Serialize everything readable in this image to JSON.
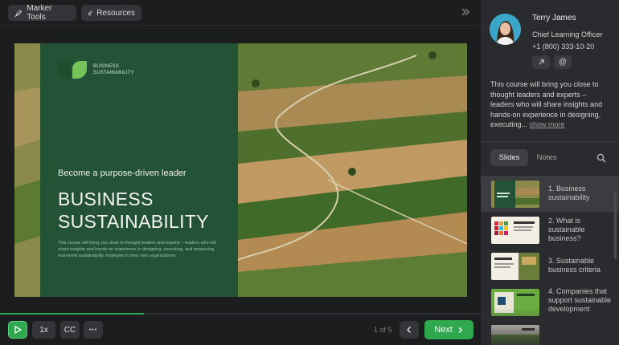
{
  "toolbar": {
    "marker_tools_label": "Marker Tools",
    "resources_label": "Resources",
    "collapse_icon": "double-chevron-right-icon"
  },
  "slide": {
    "logo_text_line1": "BUSINESS",
    "logo_text_line2": "SUSTAINABILITY",
    "kicker": "Become a purpose-driven leader",
    "title_line1": "BUSINESS",
    "title_line2": "SUSTAINABILITY",
    "description": "This course will bring you close to thought leaders and experts – leaders who will share insights and hands-on experience in designing, executing, and measuring real-world sustainability strategies in their own organizations."
  },
  "progress": {
    "fraction": 0.3,
    "color": "#2fa84f"
  },
  "controls": {
    "speed_label": "1x",
    "cc_label": "CC",
    "more_label": "•••",
    "pager": "1 of 5",
    "next_label": "Next"
  },
  "presenter": {
    "name": "Terry James",
    "role": "Chief Learning Officer",
    "phone": "+1 (800) 333-10-20"
  },
  "about": {
    "text": "This course will bring you close to thought leaders and experts – leaders who will share insights and hands-on experience in designing, executing... ",
    "more_label": "show more"
  },
  "tabs": {
    "slides": "Slides",
    "notes": "Notes"
  },
  "thumbnails": [
    {
      "label": "1. Business sustainability"
    },
    {
      "label": "2. What is sustainable business?"
    },
    {
      "label": "3. Sustainable business criteria"
    },
    {
      "label": "4. Companies that support sustainable development"
    },
    {
      "label": ""
    }
  ],
  "colors": {
    "accent": "#2fa84f",
    "panel_green": "#245236",
    "background": "#1c1d1f",
    "sidebar": "#2a2b2e"
  }
}
